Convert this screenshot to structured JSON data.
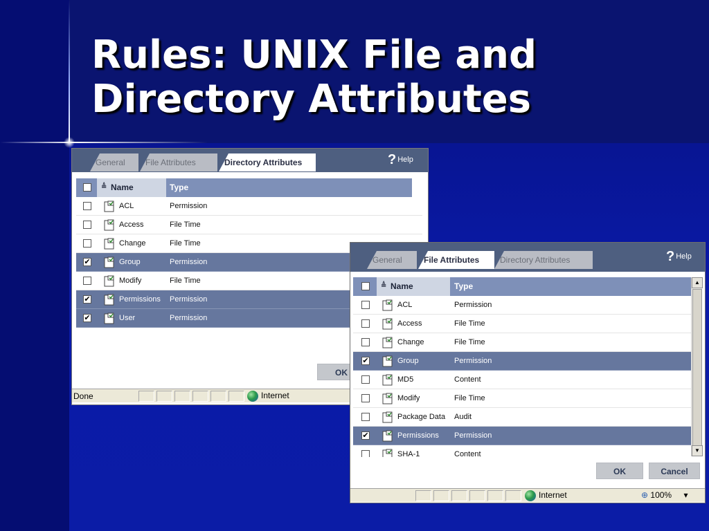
{
  "slide": {
    "title_line1": "Rules:  UNIX File and",
    "title_line2": "Directory Attributes"
  },
  "colors": {
    "background": "#0a1aa8",
    "tab_bar": "#4e5f80",
    "header_row": "#7e90b8",
    "selected_row": "#66779e",
    "button": "#c4c7cc"
  },
  "window_back": {
    "tabs": [
      {
        "label": "General",
        "active": false
      },
      {
        "label": "File Attributes",
        "active": false
      },
      {
        "label": "Directory Attributes",
        "active": true
      }
    ],
    "help_label": "Help",
    "help_icon": "question-mark-icon",
    "columns": {
      "name": "Name",
      "type": "Type"
    },
    "rows": [
      {
        "name": "ACL",
        "type": "Permission",
        "checked": false
      },
      {
        "name": "Access",
        "type": "File Time",
        "checked": false
      },
      {
        "name": "Change",
        "type": "File Time",
        "checked": false
      },
      {
        "name": "Group",
        "type": "Permission",
        "checked": true
      },
      {
        "name": "Modify",
        "type": "File Time",
        "checked": false
      },
      {
        "name": "Permissions",
        "type": "Permission",
        "checked": true
      },
      {
        "name": "User",
        "type": "Permission",
        "checked": true
      }
    ],
    "ok_label": "OK",
    "status_text": "Done",
    "zone": "Internet"
  },
  "window_front": {
    "tabs": [
      {
        "label": "General",
        "active": false
      },
      {
        "label": "File Attributes",
        "active": true
      },
      {
        "label": "Directory Attributes",
        "active": false
      }
    ],
    "help_label": "Help",
    "help_icon": "question-mark-icon",
    "columns": {
      "name": "Name",
      "type": "Type"
    },
    "rows": [
      {
        "name": "ACL",
        "type": "Permission",
        "checked": false
      },
      {
        "name": "Access",
        "type": "File Time",
        "checked": false
      },
      {
        "name": "Change",
        "type": "File Time",
        "checked": false
      },
      {
        "name": "Group",
        "type": "Permission",
        "checked": true
      },
      {
        "name": "MD5",
        "type": "Content",
        "checked": false
      },
      {
        "name": "Modify",
        "type": "File Time",
        "checked": false
      },
      {
        "name": "Package Data",
        "type": "Audit",
        "checked": false
      },
      {
        "name": "Permissions",
        "type": "Permission",
        "checked": true
      },
      {
        "name": "SHA-1",
        "type": "Content",
        "checked": false
      }
    ],
    "ok_label": "OK",
    "cancel_label": "Cancel",
    "zone": "Internet",
    "zoom": "100%"
  }
}
